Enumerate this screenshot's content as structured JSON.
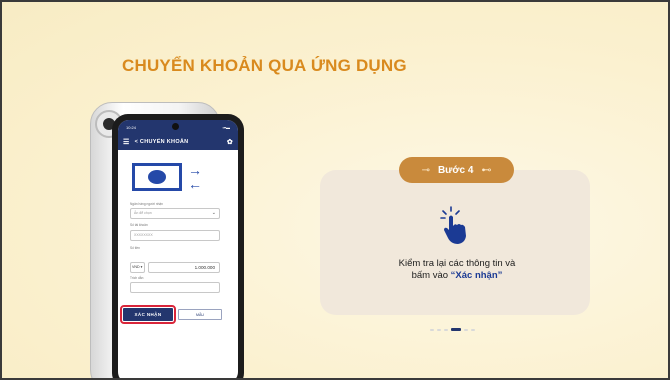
{
  "slide": {
    "title": "CHUYỂN KHOẢN QUA ỨNG DỤNG"
  },
  "phone": {
    "status_time": "10:24",
    "status_icons": "▪▾▬",
    "appbar_title": "<  CHUYỂN KHOẢN",
    "fields": {
      "bank_label": "Ngân hàng người nhận",
      "bank_value": "Ấn để chọn",
      "account_label": "Số tài khoản",
      "account_value": "XXXXXXXX",
      "amount_label": "Số tiền",
      "currency": "VND ▾",
      "amount": "1.000.000",
      "note_label": "Trích dẫn"
    },
    "confirm_button": "XÁC NHẬN",
    "save_button": "MẪU"
  },
  "card": {
    "step_label": "Bước 4",
    "desc_line1": "Kiểm tra lại các thông tin và",
    "desc_line2_prefix": "bấm vào ",
    "desc_highlight": "“Xác nhận”"
  },
  "pager": {
    "count": 6,
    "active": 3
  },
  "colors": {
    "accent": "#d98a1e",
    "pill": "#c98a3c",
    "navy": "#23366e",
    "highlight_red": "#d9253a"
  },
  "icons": {
    "hand": "tap-hand-icon",
    "settings": "gear-icon",
    "menu": "menu-icon"
  }
}
